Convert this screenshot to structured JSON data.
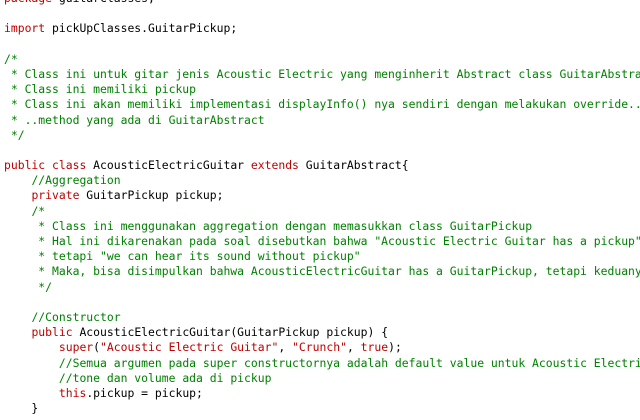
{
  "editor": {
    "lines": [
      [
        {
          "k": "kw",
          "t": "package"
        },
        {
          "k": "tx",
          "t": " guitarClasses;"
        }
      ],
      [],
      [
        {
          "k": "kw",
          "t": "import"
        },
        {
          "k": "tx",
          "t": " pickUpClasses.GuitarPickup;"
        }
      ],
      [],
      [
        {
          "k": "cm",
          "t": "/*"
        }
      ],
      [
        {
          "k": "cm",
          "t": " * Class ini untuk gitar jenis Acoustic Electric yang menginherit Abstract class GuitarAbstract"
        }
      ],
      [
        {
          "k": "cm",
          "t": " * Class ini memiliki pickup"
        }
      ],
      [
        {
          "k": "cm",
          "t": " * Class ini akan memiliki implementasi displayInfo() nya sendiri dengan melakukan override.."
        }
      ],
      [
        {
          "k": "cm",
          "t": " * ..method yang ada di GuitarAbstract"
        }
      ],
      [
        {
          "k": "cm",
          "t": " */"
        }
      ],
      [],
      [
        {
          "k": "kw",
          "t": "public"
        },
        {
          "k": "tx",
          "t": " "
        },
        {
          "k": "kw",
          "t": "class"
        },
        {
          "k": "tx",
          "t": " AcousticElectricGuitar "
        },
        {
          "k": "kw",
          "t": "extends"
        },
        {
          "k": "tx",
          "t": " GuitarAbstract{"
        }
      ],
      [
        {
          "k": "tx",
          "t": "    "
        },
        {
          "k": "cm",
          "t": "//Aggregation"
        }
      ],
      [
        {
          "k": "tx",
          "t": "    "
        },
        {
          "k": "kw",
          "t": "private"
        },
        {
          "k": "tx",
          "t": " GuitarPickup pickup;"
        }
      ],
      [
        {
          "k": "tx",
          "t": "    "
        },
        {
          "k": "cm",
          "t": "/*"
        }
      ],
      [
        {
          "k": "cm",
          "t": "     * Class ini menggunakan aggregation dengan memasukkan class GuitarPickup"
        }
      ],
      [
        {
          "k": "cm",
          "t": "     * Hal ini dikarenakan pada soal disebutkan bahwa \"Acoustic Electric Guitar has a pickup\""
        }
      ],
      [
        {
          "k": "cm",
          "t": "     * tetapi \"we can hear its sound without pickup\""
        }
      ],
      [
        {
          "k": "cm",
          "t": "     * Maka, bisa disimpulkan bahwa AcousticElectricGuitar has a GuitarPickup, tetapi keduanya tetap bi"
        }
      ],
      [
        {
          "k": "cm",
          "t": "     */"
        }
      ],
      [],
      [
        {
          "k": "tx",
          "t": "    "
        },
        {
          "k": "cm",
          "t": "//Constructor"
        }
      ],
      [
        {
          "k": "tx",
          "t": "    "
        },
        {
          "k": "kw",
          "t": "public"
        },
        {
          "k": "tx",
          "t": " AcousticElectricGuitar(GuitarPickup pickup) {"
        }
      ],
      [
        {
          "k": "tx",
          "t": "        "
        },
        {
          "k": "kw",
          "t": "super"
        },
        {
          "k": "tx",
          "t": "("
        },
        {
          "k": "st",
          "t": "\"Acoustic Electric Guitar\""
        },
        {
          "k": "tx",
          "t": ", "
        },
        {
          "k": "st",
          "t": "\"Crunch\""
        },
        {
          "k": "tx",
          "t": ", "
        },
        {
          "k": "kw",
          "t": "true"
        },
        {
          "k": "tx",
          "t": ");"
        }
      ],
      [
        {
          "k": "tx",
          "t": "        "
        },
        {
          "k": "cm",
          "t": "//Semua argumen pada super constructornya adalah default value untuk Acoustic Electric guitar"
        }
      ],
      [
        {
          "k": "tx",
          "t": "        "
        },
        {
          "k": "cm",
          "t": "//tone dan volume ada di pickup"
        }
      ],
      [
        {
          "k": "tx",
          "t": "        "
        },
        {
          "k": "kw",
          "t": "this"
        },
        {
          "k": "tx",
          "t": ".pickup = pickup;"
        }
      ],
      [
        {
          "k": "tx",
          "t": "    }"
        }
      ]
    ]
  }
}
